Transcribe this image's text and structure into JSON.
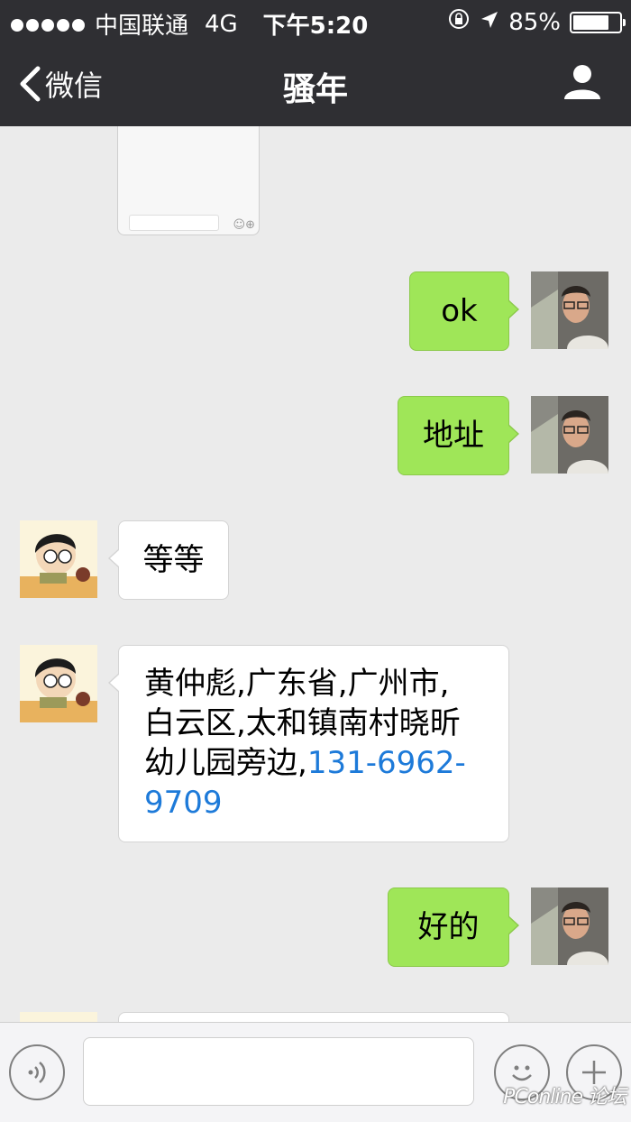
{
  "status_bar": {
    "carrier": "中国联通",
    "network": "4G",
    "time": "下午5:20",
    "battery_percent": "85%",
    "battery_level": 0.85
  },
  "nav": {
    "back_label": "微信",
    "title": "骚年",
    "profile_icon": "person-icon"
  },
  "messages": [
    {
      "sender": "me",
      "text": "ok"
    },
    {
      "sender": "me",
      "text": "地址"
    },
    {
      "sender": "them",
      "text": "等等"
    },
    {
      "sender": "them",
      "text_lines": [
        "黄仲彪,广东省,广州市,",
        "白云区,太和镇南村晓昕",
        "幼儿园旁边,"
      ],
      "phone_part1": "131-6962-",
      "phone_part2": "9709"
    },
    {
      "sender": "me",
      "text": "好的"
    }
  ],
  "input_bar": {
    "voice_icon": "voice-icon",
    "emoji_icon": "emoji-icon",
    "add_icon": "plus-icon"
  },
  "watermark": "PConline 论坛",
  "colors": {
    "bar_bg": "#2f2f33",
    "chat_bg": "#ebebeb",
    "my_bubble": "#9fe658",
    "link": "#1d7ad9"
  }
}
